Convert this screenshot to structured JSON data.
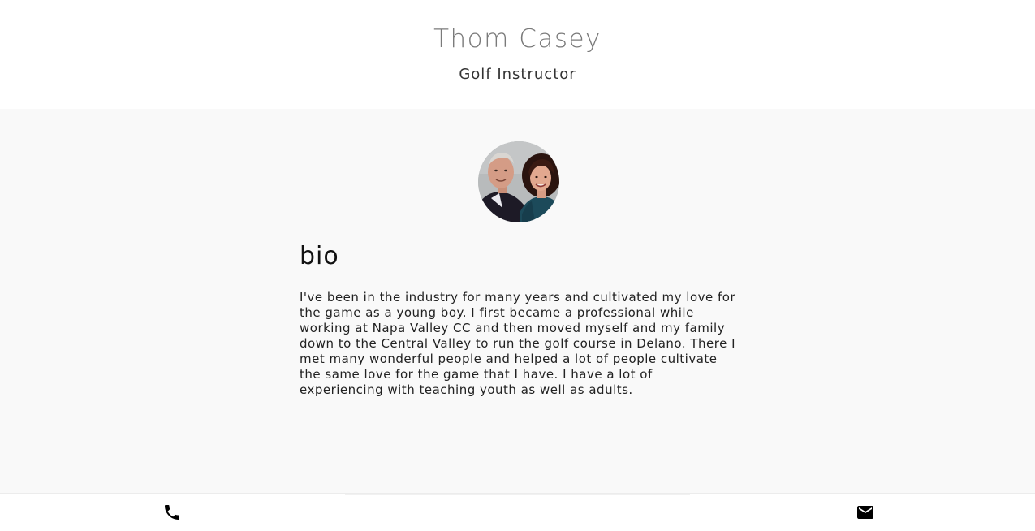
{
  "header": {
    "title": "Thom Casey",
    "subtitle": "Golf Instructor"
  },
  "profile": {
    "avatar_alt": "Thom Casey with his wife"
  },
  "bio": {
    "heading": "bio",
    "text": "I've been in the industry for many years and cultivated my love for the game as a young boy. I first became a professional while working at Napa Valley CC and then moved myself and my family down to the Central Valley to run the golf course in Delano. There I met many wonderful people and helped a lot of people cultivate the same love for the game that I have. I have a lot of experiencing with teaching youth as well as adults."
  },
  "footer": {
    "icons": [
      "phone-icon",
      "email-icon"
    ]
  },
  "colors": {
    "header_bg": "#ffffff",
    "main_bg": "#f9f9f9",
    "title": "#7a7a7a",
    "icon": "#000000"
  }
}
